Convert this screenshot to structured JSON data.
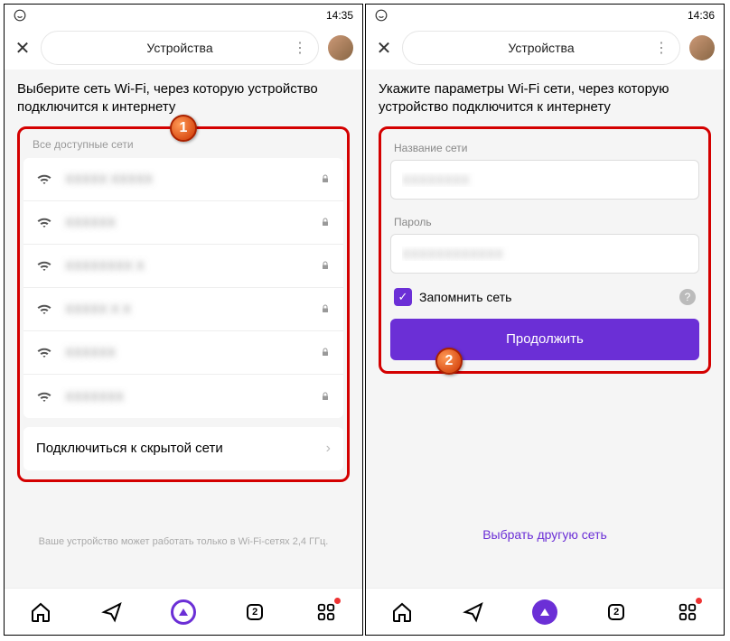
{
  "screen1": {
    "status": {
      "time": "14:35"
    },
    "header": {
      "title": "Устройства"
    },
    "instruction": "Выберите сеть Wi-Fi, через которую устройство подключится к интернету",
    "section_label": "Все доступные сети",
    "networks": [
      {
        "name": "XXXXX XXXXX"
      },
      {
        "name": "XXXXXX"
      },
      {
        "name": "XXXXXXXX X"
      },
      {
        "name": "XXXXX X X"
      },
      {
        "name": "XXXXXX"
      },
      {
        "name": "XXXXXXX"
      }
    ],
    "hidden_network_label": "Подключиться к скрытой сети",
    "footer_note": "Ваше устройство может работать только в Wi-Fi-сетях 2,4 ГГц.",
    "nav_count": "2",
    "marker": "1"
  },
  "screen2": {
    "status": {
      "time": "14:36"
    },
    "header": {
      "title": "Устройства"
    },
    "instruction": "Укажите параметры Wi-Fi сети, через которую устройство подключится к интернету",
    "ssid_label": "Название сети",
    "ssid_value": "XXXXXXXX",
    "pwd_label": "Пароль",
    "pwd_value": "XXXXXXXXXXXX",
    "remember_label": "Запомнить сеть",
    "continue_label": "Продолжить",
    "alt_link": "Выбрать другую сеть",
    "nav_count": "2",
    "marker": "2"
  }
}
